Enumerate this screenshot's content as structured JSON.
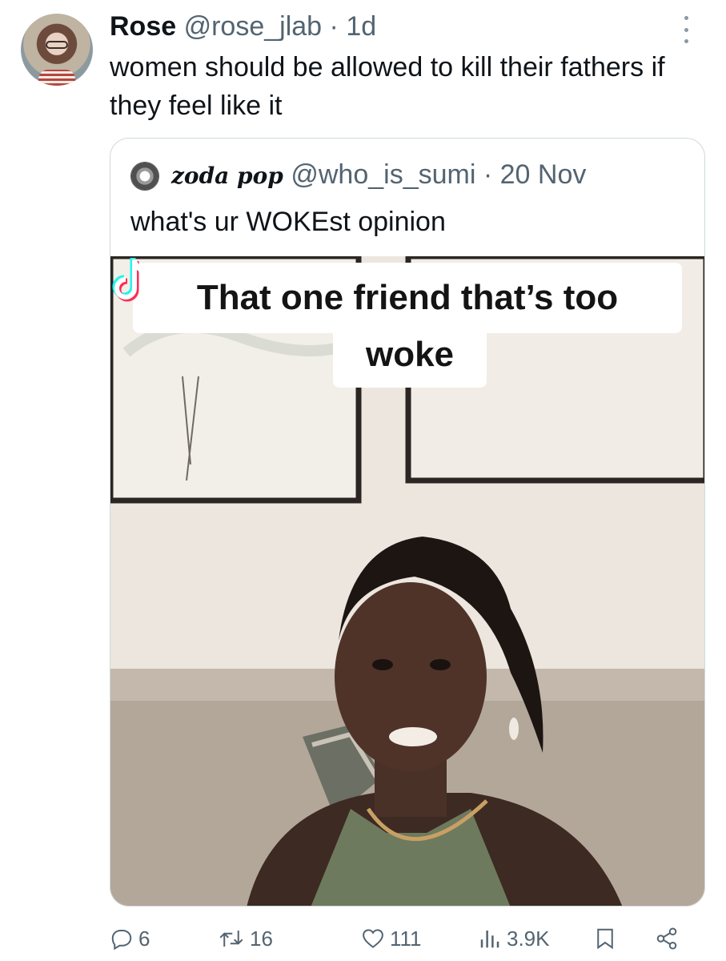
{
  "tweet": {
    "author_name": "Rose",
    "author_handle": "@rose_jlab",
    "separator": "·",
    "time_ago": "1d",
    "text": "women should be allowed to kill their fathers if they feel like it"
  },
  "quoted_tweet": {
    "author_name": "zoda pop",
    "author_handle": "@who_is_sumi",
    "separator": "·",
    "date": "20 Nov",
    "text": "what's ur WOKEst opinion",
    "media": {
      "caption_line1": "That one friend that’s too",
      "caption_line2": "woke",
      "watermark_icon": "tiktok-icon"
    }
  },
  "actions": {
    "replies": "6",
    "retweets": "16",
    "likes": "111",
    "views": "3.9K"
  },
  "icons": [
    "more-icon",
    "reply-icon",
    "retweet-icon",
    "like-icon",
    "views-icon",
    "bookmark-icon",
    "share-icon"
  ],
  "colors": {
    "text_primary": "#0f1419",
    "text_secondary": "#536471",
    "border": "#cfd9de"
  }
}
